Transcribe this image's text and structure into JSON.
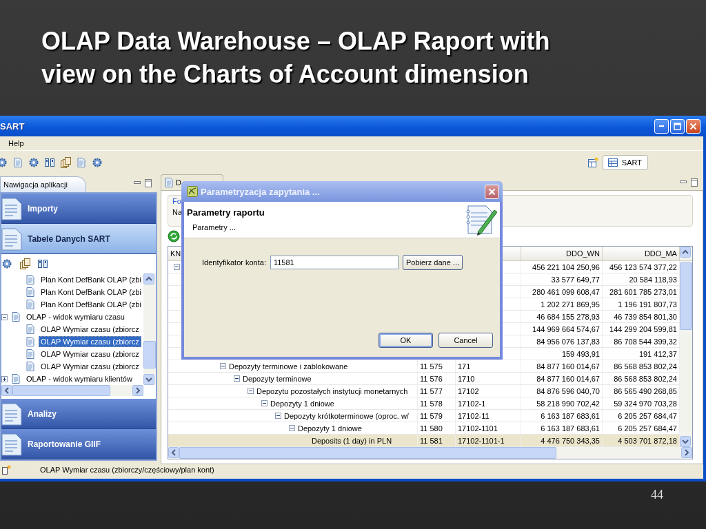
{
  "slide": {
    "title": "OLAP Data Warehouse – OLAP Raport with view on the Charts of Account dimension",
    "page_number": "44"
  },
  "window": {
    "title": "SART",
    "menu": [
      "Help"
    ],
    "perspective": "SART"
  },
  "navigation": {
    "tab": "Nawigacja aplikacji",
    "categories": [
      {
        "label": "Importy",
        "selected": false
      },
      {
        "label": "Tabele Danych SART",
        "selected": true
      },
      {
        "label": "Analizy",
        "selected": false
      },
      {
        "label": "Raportowanie GIIF",
        "selected": false
      }
    ],
    "tree": [
      {
        "children": [
          {
            "label": "Plan Kont DefBank OLAP (zbi",
            "selected": false
          },
          {
            "label": "Plan Kont DefBank OLAP (zbi",
            "selected": false
          },
          {
            "label": "Plan Kont DefBank OLAP (zbi",
            "selected": false
          }
        ]
      },
      {
        "label": "OLAP - widok wymiaru czasu",
        "expanded": true,
        "children": [
          {
            "label": "OLAP Wymiar czasu (zbiorcz",
            "selected": false
          },
          {
            "label": "OLAP Wymiar czasu (zbiorcz",
            "selected": true
          },
          {
            "label": "OLAP Wymiar czasu (zbiorcz",
            "selected": false
          },
          {
            "label": "OLAP Wymiar czasu (zbiorcz",
            "selected": false
          }
        ]
      },
      {
        "label": "OLAP - widok wymiaru klientów",
        "expanded": false
      }
    ]
  },
  "editor": {
    "tabs": [
      "D"
    ],
    "group_label": "Fo",
    "field_label": "Na",
    "table": {
      "first_column": "KN",
      "value_columns": [
        "DDO_WN",
        "DDO_MA"
      ],
      "rows": [
        {
          "expanded": true,
          "selected": false,
          "ddo_wn": "456 221 104 250,96",
          "ddo_ma": "456 123 574 377,22",
          "children": [
            {
              "selected": false,
              "ddo_wn": "33 577 649,77",
              "ddo_ma": "20 584 118,93"
            },
            {
              "selected": false,
              "ddo_wn": "280 461 099 608,47",
              "ddo_ma": "281 601 785 273,01"
            },
            {
              "selected": false,
              "ddo_wn": "1 202 271 869,95",
              "ddo_ma": "1 196 191 807,73"
            },
            {
              "selected": false,
              "ddo_wn": "46 684 155 278,93",
              "ddo_ma": "46 739 854 801,30"
            },
            {
              "selected": false,
              "ddo_wn": "144 969 664 574,67",
              "ddo_ma": "144 299 204 599,81"
            },
            {
              "selected": false,
              "ddo_wn": "84 956 076 137,83",
              "ddo_ma": "86 708 544 399,32"
            },
            {
              "selected": false,
              "ddo_wn": "159 493,91",
              "ddo_ma": "191 412,37"
            },
            {
              "name": "Depozyty terminowe i zablokowane",
              "number": "11 575",
              "code": "171",
              "ddo_wn": "84 877 160 014,67",
              "ddo_ma": "86 568 853 802,24",
              "expanded": true,
              "selected": false,
              "children": [
                {
                  "name": "Depozyty terminowe",
                  "number": "11 576",
                  "code": "1710",
                  "ddo_wn": "84 877 160 014,67",
                  "ddo_ma": "86 568 853 802,24",
                  "expanded": true,
                  "selected": false,
                  "children": [
                    {
                      "name": "Depozytu pozostałych instytucji monetarnych",
                      "number": "11 577",
                      "code": "17102",
                      "ddo_wn": "84 876 596 040,70",
                      "ddo_ma": "86 565 490 268,85",
                      "expanded": true,
                      "selected": false,
                      "children": [
                        {
                          "name": "Depozyty 1 dniowe",
                          "number": "11 578",
                          "code": "17102-1",
                          "ddo_wn": "58 218 990 702,42",
                          "ddo_ma": "59 324 970 703,28",
                          "expanded": true,
                          "selected": false,
                          "children": [
                            {
                              "name": "Depozyty krótkoterminowe (oproc. w/",
                              "number": "11 579",
                              "code": "17102-11",
                              "ddo_wn": "6 163 187 683,61",
                              "ddo_ma": "6 205 257 684,47",
                              "expanded": true,
                              "selected": false,
                              "children": [
                                {
                                  "name": "Depozyty 1 dniowe",
                                  "number": "11 580",
                                  "code": "17102-1101",
                                  "ddo_wn": "6 163 187 683,61",
                                  "ddo_ma": "6 205 257 684,47",
                                  "expanded": true,
                                  "selected": false,
                                  "children": [
                                    {
                                      "name": "Deposits (1 day) in PLN",
                                      "number": "11 581",
                                      "code": "17102-1101-1",
                                      "ddo_wn": "4 476 750 343,35",
                                      "ddo_ma": "4 503 701 872,18",
                                      "selected": true
                                    }
                                  ]
                                }
                              ]
                            }
                          ]
                        }
                      ]
                    }
                  ]
                }
              ]
            }
          ]
        }
      ]
    }
  },
  "dialog": {
    "title": "Parametryzacja zapytania ...",
    "heading": "Parametry raportu",
    "subheading": "Parametry ...",
    "field_label": "Identyfikator konta:",
    "field_value": "11581",
    "fetch_button": "Pobierz dane ...",
    "buttons": [
      "OK",
      "Cancel"
    ]
  },
  "status_bar": {
    "text": "OLAP Wymiar czasu (zbiorczy/częściowy/plan kont)"
  }
}
